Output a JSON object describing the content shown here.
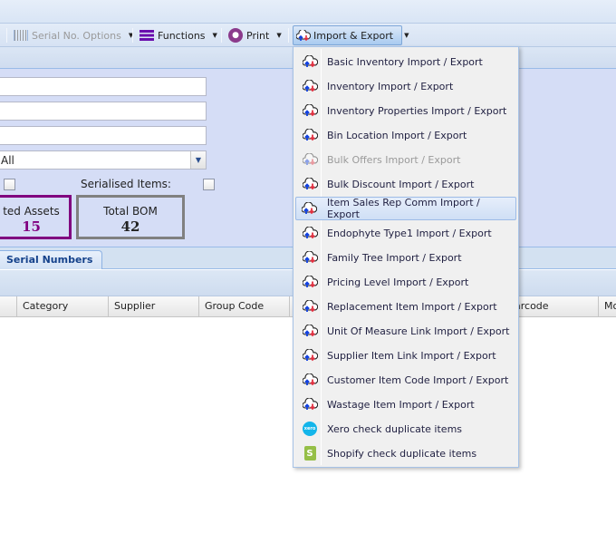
{
  "toolbar": {
    "serial_options": "Serial No. Options",
    "functions": "Functions",
    "print": "Print",
    "import_export": "Import & Export"
  },
  "filters": {
    "combo_value": "All",
    "serialised_items_label": "Serialised Items:",
    "serialised_items_checked": false,
    "other_checkbox_checked": false
  },
  "stats": [
    {
      "label": "ted Assets",
      "value": "15",
      "color": "#800080"
    },
    {
      "label": "Total BOM",
      "value": "42",
      "color": "#808080"
    }
  ],
  "tabs": [
    {
      "label": "Serial Numbers"
    }
  ],
  "grid": {
    "columns": [
      "",
      "Category",
      "Supplier",
      "Group Code",
      "",
      "",
      "arcode",
      "Mo"
    ]
  },
  "menu": {
    "items": [
      {
        "label": "Basic Inventory Import / Export",
        "icon": "cloud-import-export-icon"
      },
      {
        "label": "Inventory Import / Export",
        "icon": "cloud-import-export-icon"
      },
      {
        "label": "Inventory Properties Import / Export",
        "icon": "cloud-import-export-icon"
      },
      {
        "label": "Bin Location Import / Export",
        "icon": "cloud-import-export-icon"
      },
      {
        "label": "Bulk Offers Import / Export",
        "icon": "cloud-import-export-icon",
        "disabled": true
      },
      {
        "label": "Bulk Discount Import / Export",
        "icon": "cloud-import-export-icon"
      },
      {
        "label": "Item Sales Rep Comm Import / Export",
        "icon": "cloud-import-export-icon",
        "highlighted": true
      },
      {
        "label": "Endophyte Type1 Import / Export",
        "icon": "cloud-import-export-icon"
      },
      {
        "label": "Family Tree Import / Export",
        "icon": "cloud-import-export-icon"
      },
      {
        "label": "Pricing Level Import / Export",
        "icon": "cloud-import-export-icon"
      },
      {
        "label": "Replacement Item Import / Export",
        "icon": "cloud-import-export-icon"
      },
      {
        "label": "Unit Of Measure Link Import / Export",
        "icon": "cloud-import-export-icon"
      },
      {
        "label": "Supplier Item Link Import / Export",
        "icon": "cloud-import-export-icon"
      },
      {
        "label": "Customer Item Code Import / Export",
        "icon": "cloud-import-export-icon"
      },
      {
        "label": "Wastage Item Import / Export",
        "icon": "cloud-import-export-icon"
      },
      {
        "label": "Xero check duplicate items",
        "icon": "xero-icon"
      },
      {
        "label": "Shopify check duplicate items",
        "icon": "shopify-icon"
      }
    ]
  }
}
